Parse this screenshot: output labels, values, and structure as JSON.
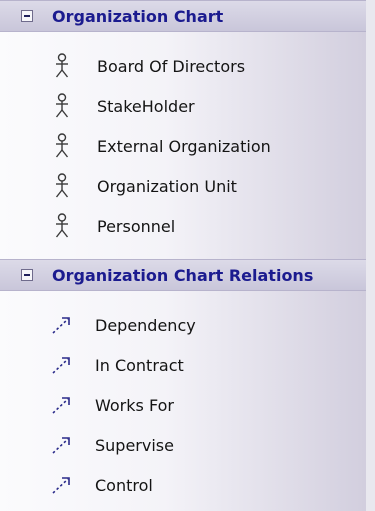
{
  "sections": [
    {
      "title": "Organization Chart",
      "items": [
        {
          "label": "Board Of Directors",
          "icon": "actor-icon"
        },
        {
          "label": "StakeHolder",
          "icon": "actor-icon"
        },
        {
          "label": "External Organization",
          "icon": "actor-icon"
        },
        {
          "label": "Organization Unit",
          "icon": "actor-icon"
        },
        {
          "label": "Personnel",
          "icon": "actor-icon"
        }
      ]
    },
    {
      "title": "Organization Chart Relations",
      "items": [
        {
          "label": "Dependency",
          "icon": "dependency-arrow-icon"
        },
        {
          "label": "In Contract",
          "icon": "dependency-arrow-icon"
        },
        {
          "label": "Works For",
          "icon": "dependency-arrow-icon"
        },
        {
          "label": "Supervise",
          "icon": "dependency-arrow-icon"
        },
        {
          "label": "Control",
          "icon": "dependency-arrow-icon"
        }
      ]
    }
  ],
  "colors": {
    "header_text": "#1b1b8f",
    "item_text": "#141414",
    "icon_dark": "#3a3a3a",
    "arrow": "#2b2b8a"
  }
}
